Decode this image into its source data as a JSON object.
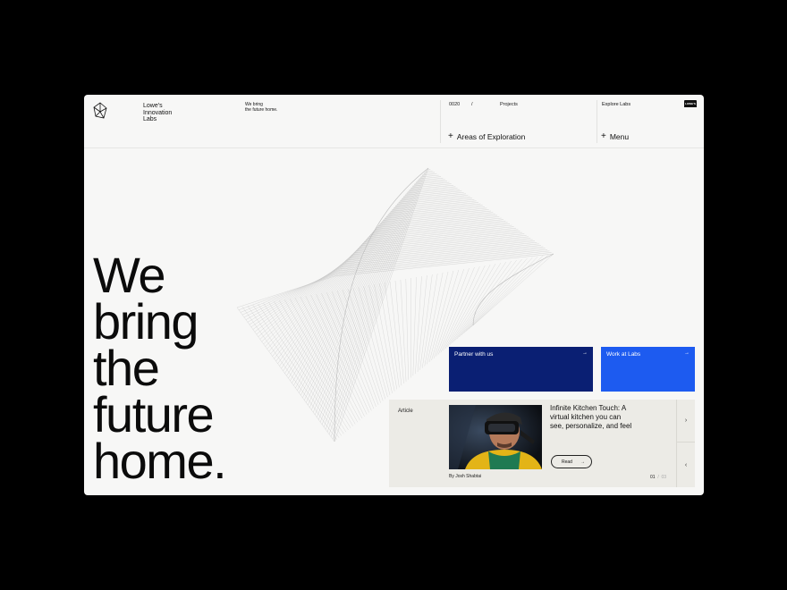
{
  "brand": {
    "line1": "Lowe's",
    "line2": "Innovation",
    "line3": "Labs"
  },
  "tagline": {
    "line1": "We bring",
    "line2": "the future home."
  },
  "breadcrumb": {
    "number": "0020",
    "separator": "/",
    "section": "Projects"
  },
  "header": {
    "areas_label": "Areas of Exploration",
    "explore_label": "Explore Labs",
    "menu_label": "Menu",
    "badge": "LOWE'S"
  },
  "hero": {
    "line1": "We",
    "line2": "bring",
    "line3": "the",
    "line4": "future",
    "line5": "home."
  },
  "cards": {
    "partner_label": "Partner with us",
    "work_label": "Work at Labs",
    "arrow": "→"
  },
  "article": {
    "label": "Article",
    "title": "Infinite Kitchen Touch: A virtual kitchen you can see, personalize, and feel",
    "read_label": "Read",
    "read_arrow": "→",
    "byline": "By Josh Shabtai",
    "page_current": "01",
    "page_sep": "/",
    "page_total": "03",
    "next_icon": "›",
    "prev_icon": "‹"
  },
  "colors": {
    "partner": "#0a1f73",
    "work": "#1d5bf0",
    "background": "#f7f7f6",
    "article_bg": "#ecebe6"
  }
}
